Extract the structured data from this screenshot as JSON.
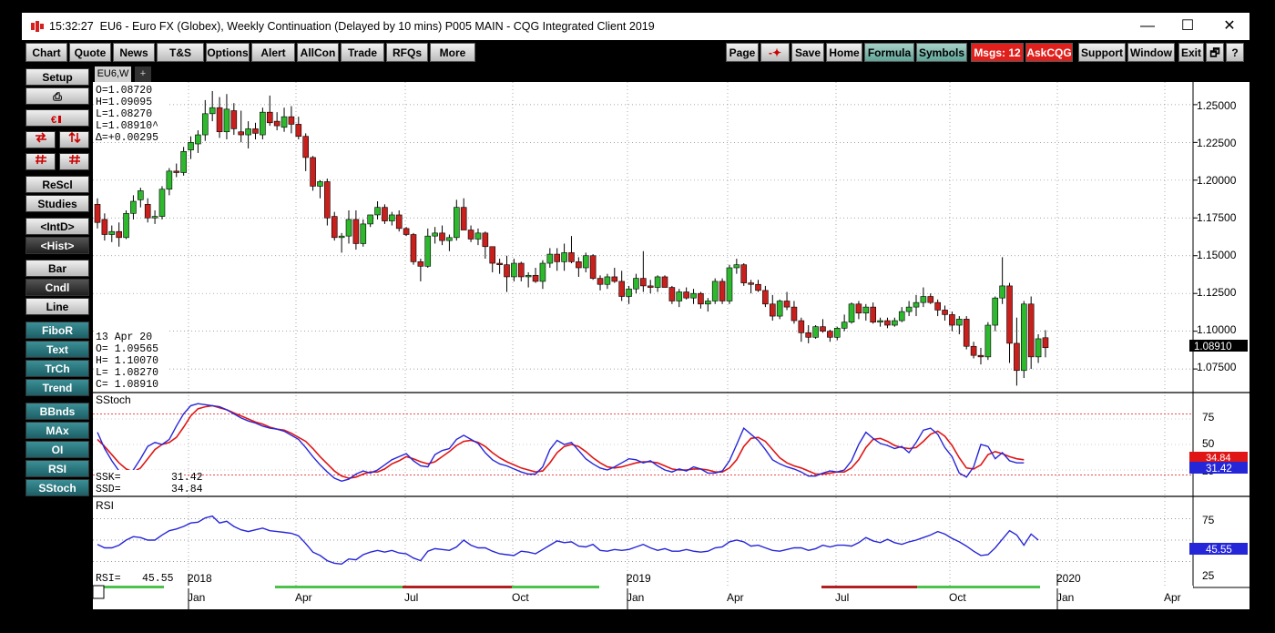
{
  "titlebar": {
    "time": "15:32:27",
    "title": "EU6 - Euro FX (Globex), Weekly Continuation (Delayed by 10 mins)   P005 MAIN - CQG Integrated Client 2019",
    "minimize": "—",
    "maximize": "☐",
    "close": "✕"
  },
  "toolbar": {
    "left": [
      "Chart",
      "Quote",
      "News",
      "T&S",
      "Options",
      "Alert",
      "AllCon",
      "Trade",
      "RFQs",
      "More"
    ],
    "page": "Page",
    "arrow": "-✦",
    "save": "Save",
    "home": "Home",
    "formula": "Formula",
    "symbols": "Symbols",
    "msgs": "Msgs: 12",
    "askcqg": "AskCQG",
    "support": "Support",
    "window": "Window",
    "exit": "Exit",
    "restore": "🗗",
    "help": "?"
  },
  "sidebar": {
    "setup": "Setup",
    "print_icon": "⎙",
    "rescl": "ReScl",
    "studies": "Studies",
    "intd": "<IntD>",
    "hist": "<Hist>",
    "bar": "Bar",
    "cndl": "Cndl",
    "line": "Line",
    "fibor": "FiboR",
    "text": "Text",
    "trch": "TrCh",
    "trend": "Trend",
    "bbnds": "BBnds",
    "max": "MAx",
    "oi": "OI",
    "rsi": "RSI",
    "sstoch": "SStoch"
  },
  "tabs": {
    "active": "EU6,W",
    "add": "+"
  },
  "ohlc_box": {
    "o": "O=1.08720",
    "h": "H=1.09095",
    "l": "L=1.08270",
    "last": "L=1.08910^",
    "delta": "Δ=+0.00295"
  },
  "bar_info": {
    "date": "13 Apr 20",
    "o": "O= 1.09565",
    "h": "H= 1.10070",
    "l": "L= 1.08270",
    "c": "C= 1.08910"
  },
  "price_axis": {
    "ticks": [
      "1.25000",
      "1.22500",
      "1.20000",
      "1.17500",
      "1.15000",
      "1.12500",
      "1.10000",
      "1.07500"
    ],
    "last": "1.08910"
  },
  "sstoch": {
    "title": "SStoch",
    "ssk_label": "SSK=",
    "ssk": "31.42",
    "ssd_label": "SSD=",
    "ssd": "34.84",
    "ticks": [
      "75",
      "50",
      "25"
    ],
    "badge_ssd": "34.84",
    "badge_ssk": "31.42"
  },
  "rsi": {
    "title": "RSI",
    "label": "RSI=",
    "value": "45.55",
    "ticks": [
      "75",
      "25"
    ],
    "badge": "45.55"
  },
  "time_axis": {
    "years": [
      "2018",
      "2019",
      "2020"
    ],
    "months": [
      "Jan",
      "Apr",
      "Jul",
      "Oct",
      "Jan",
      "Apr",
      "Jul",
      "Oct",
      "Jan",
      "Apr"
    ]
  },
  "colors": {
    "up": "#2eb82e",
    "down": "#c8201d",
    "ssk": "#2626d9",
    "ssd": "#e01515",
    "rsi": "#2626d9",
    "teal_button": "#2a7a82",
    "alert_red": "#e0201c"
  },
  "chart_data": {
    "type": "candlestick",
    "interval": "weekly",
    "symbol": "EU6",
    "ylim": [
      1.06,
      1.265
    ],
    "candles": [
      [
        1.184,
        1.188,
        1.168,
        1.172
      ],
      [
        1.174,
        1.178,
        1.16,
        1.164
      ],
      [
        1.164,
        1.17,
        1.159,
        1.166
      ],
      [
        1.166,
        1.172,
        1.156,
        1.162
      ],
      [
        1.162,
        1.18,
        1.161,
        1.178
      ],
      [
        1.178,
        1.19,
        1.174,
        1.186
      ],
      [
        1.187,
        1.195,
        1.182,
        1.193
      ],
      [
        1.184,
        1.188,
        1.172,
        1.175
      ],
      [
        1.175,
        1.18,
        1.171,
        1.176
      ],
      [
        1.176,
        1.196,
        1.174,
        1.194
      ],
      [
        1.194,
        1.208,
        1.19,
        1.206
      ],
      [
        1.206,
        1.211,
        1.202,
        1.205
      ],
      [
        1.205,
        1.222,
        1.203,
        1.219
      ],
      [
        1.22,
        1.229,
        1.214,
        1.225
      ],
      [
        1.224,
        1.233,
        1.218,
        1.23
      ],
      [
        1.23,
        1.253,
        1.226,
        1.244
      ],
      [
        1.244,
        1.259,
        1.239,
        1.248
      ],
      [
        1.248,
        1.255,
        1.228,
        1.232
      ],
      [
        1.232,
        1.257,
        1.227,
        1.247
      ],
      [
        1.246,
        1.251,
        1.23,
        1.234
      ],
      [
        1.232,
        1.246,
        1.225,
        1.23
      ],
      [
        1.23,
        1.239,
        1.221,
        1.234
      ],
      [
        1.234,
        1.238,
        1.227,
        1.231
      ],
      [
        1.23,
        1.248,
        1.227,
        1.245
      ],
      [
        1.245,
        1.256,
        1.236,
        1.238
      ],
      [
        1.239,
        1.245,
        1.233,
        1.236
      ],
      [
        1.235,
        1.248,
        1.232,
        1.242
      ],
      [
        1.242,
        1.249,
        1.231,
        1.237
      ],
      [
        1.237,
        1.242,
        1.227,
        1.229
      ],
      [
        1.229,
        1.231,
        1.206,
        1.215
      ],
      [
        1.215,
        1.216,
        1.193,
        1.196
      ],
      [
        1.196,
        1.2,
        1.188,
        1.199
      ],
      [
        1.199,
        1.201,
        1.17,
        1.175
      ],
      [
        1.176,
        1.179,
        1.16,
        1.162
      ],
      [
        1.162,
        1.165,
        1.152,
        1.163
      ],
      [
        1.163,
        1.18,
        1.158,
        1.174
      ],
      [
        1.174,
        1.18,
        1.154,
        1.158
      ],
      [
        1.158,
        1.174,
        1.156,
        1.171
      ],
      [
        1.171,
        1.177,
        1.169,
        1.177
      ],
      [
        1.177,
        1.186,
        1.174,
        1.182
      ],
      [
        1.182,
        1.184,
        1.171,
        1.173
      ],
      [
        1.173,
        1.179,
        1.17,
        1.177
      ],
      [
        1.177,
        1.18,
        1.166,
        1.168
      ],
      [
        1.168,
        1.169,
        1.163,
        1.164
      ],
      [
        1.164,
        1.165,
        1.144,
        1.146
      ],
      [
        1.146,
        1.148,
        1.133,
        1.143
      ],
      [
        1.143,
        1.168,
        1.142,
        1.163
      ],
      [
        1.163,
        1.169,
        1.158,
        1.165
      ],
      [
        1.165,
        1.17,
        1.157,
        1.16
      ],
      [
        1.16,
        1.164,
        1.153,
        1.162
      ],
      [
        1.162,
        1.187,
        1.16,
        1.182
      ],
      [
        1.182,
        1.188,
        1.167,
        1.167
      ],
      [
        1.167,
        1.17,
        1.159,
        1.161
      ],
      [
        1.161,
        1.168,
        1.157,
        1.165
      ],
      [
        1.165,
        1.166,
        1.148,
        1.156
      ],
      [
        1.156,
        1.156,
        1.139,
        1.145
      ],
      [
        1.145,
        1.148,
        1.138,
        1.144
      ],
      [
        1.144,
        1.15,
        1.126,
        1.136
      ],
      [
        1.136,
        1.148,
        1.133,
        1.145
      ],
      [
        1.145,
        1.146,
        1.133,
        1.136
      ],
      [
        1.136,
        1.139,
        1.129,
        1.137
      ],
      [
        1.137,
        1.142,
        1.132,
        1.133
      ],
      [
        1.133,
        1.147,
        1.128,
        1.145
      ],
      [
        1.145,
        1.155,
        1.142,
        1.151
      ],
      [
        1.151,
        1.155,
        1.14,
        1.146
      ],
      [
        1.146,
        1.158,
        1.14,
        1.152
      ],
      [
        1.152,
        1.163,
        1.145,
        1.146
      ],
      [
        1.146,
        1.149,
        1.136,
        1.142
      ],
      [
        1.142,
        1.152,
        1.139,
        1.15
      ],
      [
        1.15,
        1.151,
        1.134,
        1.135
      ],
      [
        1.135,
        1.137,
        1.127,
        1.131
      ],
      [
        1.131,
        1.138,
        1.128,
        1.136
      ],
      [
        1.136,
        1.142,
        1.132,
        1.133
      ],
      [
        1.133,
        1.14,
        1.12,
        1.123
      ],
      [
        1.123,
        1.13,
        1.118,
        1.128
      ],
      [
        1.128,
        1.138,
        1.125,
        1.135
      ],
      [
        1.135,
        1.153,
        1.126,
        1.13
      ],
      [
        1.13,
        1.134,
        1.125,
        1.129
      ],
      [
        1.129,
        1.137,
        1.126,
        1.136
      ],
      [
        1.136,
        1.137,
        1.129,
        1.129
      ],
      [
        1.129,
        1.13,
        1.118,
        1.12
      ],
      [
        1.12,
        1.128,
        1.116,
        1.126
      ],
      [
        1.126,
        1.129,
        1.121,
        1.122
      ],
      [
        1.122,
        1.128,
        1.118,
        1.125
      ],
      [
        1.125,
        1.126,
        1.115,
        1.118
      ],
      [
        1.118,
        1.122,
        1.113,
        1.12
      ],
      [
        1.12,
        1.135,
        1.118,
        1.133
      ],
      [
        1.133,
        1.135,
        1.118,
        1.12
      ],
      [
        1.12,
        1.144,
        1.118,
        1.142
      ],
      [
        1.142,
        1.148,
        1.138,
        1.144
      ],
      [
        1.144,
        1.145,
        1.13,
        1.132
      ],
      [
        1.132,
        1.134,
        1.125,
        1.131
      ],
      [
        1.131,
        1.134,
        1.126,
        1.127
      ],
      [
        1.127,
        1.13,
        1.116,
        1.118
      ],
      [
        1.118,
        1.124,
        1.107,
        1.11
      ],
      [
        1.11,
        1.121,
        1.108,
        1.12
      ],
      [
        1.12,
        1.126,
        1.114,
        1.116
      ],
      [
        1.116,
        1.12,
        1.105,
        1.107
      ],
      [
        1.107,
        1.109,
        1.093,
        1.099
      ],
      [
        1.099,
        1.104,
        1.092,
        1.096
      ],
      [
        1.096,
        1.104,
        1.095,
        1.103
      ],
      [
        1.103,
        1.108,
        1.099,
        1.1
      ],
      [
        1.1,
        1.101,
        1.093,
        1.096
      ],
      [
        1.096,
        1.103,
        1.094,
        1.102
      ],
      [
        1.102,
        1.111,
        1.1,
        1.106
      ],
      [
        1.106,
        1.119,
        1.105,
        1.118
      ],
      [
        1.118,
        1.12,
        1.108,
        1.112
      ],
      [
        1.112,
        1.118,
        1.107,
        1.116
      ],
      [
        1.116,
        1.119,
        1.105,
        1.106
      ],
      [
        1.106,
        1.109,
        1.103,
        1.107
      ],
      [
        1.107,
        1.109,
        1.102,
        1.104
      ],
      [
        1.104,
        1.109,
        1.103,
        1.107
      ],
      [
        1.107,
        1.116,
        1.106,
        1.113
      ],
      [
        1.113,
        1.12,
        1.11,
        1.116
      ],
      [
        1.116,
        1.124,
        1.11,
        1.119
      ],
      [
        1.119,
        1.129,
        1.116,
        1.123
      ],
      [
        1.123,
        1.125,
        1.118,
        1.119
      ],
      [
        1.119,
        1.121,
        1.11,
        1.114
      ],
      [
        1.114,
        1.117,
        1.107,
        1.111
      ],
      [
        1.111,
        1.113,
        1.1,
        1.104
      ],
      [
        1.104,
        1.11,
        1.098,
        1.108
      ],
      [
        1.108,
        1.11,
        1.088,
        1.09
      ],
      [
        1.09,
        1.093,
        1.082,
        1.084
      ],
      [
        1.084,
        1.089,
        1.078,
        1.083
      ],
      [
        1.083,
        1.106,
        1.081,
        1.104
      ],
      [
        1.104,
        1.123,
        1.1,
        1.122
      ],
      [
        1.122,
        1.149,
        1.118,
        1.13
      ],
      [
        1.13,
        1.132,
        1.079,
        1.092
      ],
      [
        1.092,
        1.109,
        1.064,
        1.074
      ],
      [
        1.074,
        1.12,
        1.069,
        1.118
      ],
      [
        1.118,
        1.123,
        1.075,
        1.083
      ],
      [
        1.083,
        1.098,
        1.079,
        1.095
      ],
      [
        1.0957,
        1.1007,
        1.0827,
        1.0891
      ]
    ],
    "sstoch_ssk": [
      62,
      46,
      34,
      24,
      20,
      25,
      36,
      48,
      52,
      50,
      55,
      68,
      80,
      88,
      90,
      89,
      88,
      87,
      84,
      80,
      76,
      73,
      71,
      68,
      66,
      65,
      63,
      59,
      55,
      47,
      38,
      30,
      23,
      17,
      14,
      16,
      21,
      24,
      22,
      25,
      30,
      35,
      38,
      41,
      34,
      29,
      28,
      40,
      44,
      46,
      55,
      59,
      55,
      51,
      42,
      35,
      31,
      29,
      26,
      23,
      21,
      21,
      28,
      45,
      54,
      50,
      52,
      44,
      36,
      31,
      27,
      25,
      28,
      32,
      36,
      35,
      32,
      34,
      29,
      25,
      23,
      26,
      24,
      28,
      26,
      22,
      22,
      24,
      34,
      50,
      66,
      60,
      54,
      45,
      35,
      31,
      28,
      26,
      23,
      19,
      19,
      22,
      24,
      23,
      25,
      34,
      50,
      62,
      56,
      51,
      49,
      46,
      48,
      42,
      52,
      64,
      66,
      60,
      47,
      38,
      22,
      18,
      28,
      50,
      48,
      36,
      42,
      34,
      32,
      32
    ],
    "sstoch_ssd": [
      55,
      48,
      40,
      32,
      26,
      23,
      27,
      36,
      45,
      50,
      52,
      57,
      67,
      78,
      85,
      87,
      88,
      86,
      84,
      81,
      78,
      75,
      72,
      70,
      67,
      65,
      64,
      61,
      57,
      53,
      46,
      38,
      31,
      24,
      19,
      17,
      18,
      21,
      23,
      23,
      26,
      31,
      34,
      38,
      36,
      33,
      31,
      33,
      38,
      43,
      49,
      53,
      54,
      52,
      48,
      42,
      37,
      33,
      30,
      27,
      25,
      23,
      24,
      32,
      42,
      48,
      50,
      48,
      43,
      37,
      32,
      28,
      27,
      28,
      30,
      32,
      33,
      33,
      32,
      29,
      26,
      25,
      25,
      26,
      26,
      25,
      23,
      23,
      27,
      35,
      48,
      56,
      57,
      53,
      45,
      37,
      32,
      29,
      27,
      24,
      21,
      21,
      22,
      23,
      23,
      27,
      35,
      47,
      55,
      56,
      53,
      49,
      47,
      46,
      47,
      53,
      60,
      63,
      58,
      49,
      37,
      27,
      26,
      30,
      40,
      43,
      41,
      38,
      36,
      35
    ],
    "rsi": [
      45,
      41,
      41,
      44,
      50,
      54,
      53,
      50,
      50,
      56,
      61,
      63,
      66,
      70,
      71,
      76,
      78,
      70,
      72,
      66,
      62,
      60,
      62,
      64,
      61,
      60,
      59,
      58,
      55,
      46,
      36,
      32,
      26,
      23,
      22,
      28,
      27,
      33,
      36,
      38,
      36,
      38,
      35,
      34,
      29,
      26,
      37,
      40,
      39,
      38,
      42,
      50,
      44,
      41,
      41,
      37,
      34,
      33,
      32,
      37,
      36,
      34,
      39,
      44,
      49,
      47,
      48,
      43,
      42,
      45,
      38,
      37,
      39,
      38,
      39,
      42,
      45,
      41,
      38,
      40,
      37,
      37,
      39,
      37,
      36,
      37,
      41,
      42,
      48,
      50,
      48,
      43,
      44,
      41,
      38,
      37,
      39,
      41,
      41,
      38,
      40,
      44,
      42,
      44,
      44,
      43,
      47,
      53,
      49,
      47,
      51,
      47,
      45,
      48,
      50,
      53,
      56,
      60,
      57,
      52,
      48,
      43,
      37,
      32,
      33,
      41,
      51,
      61,
      56,
      44,
      57,
      50
    ]
  }
}
